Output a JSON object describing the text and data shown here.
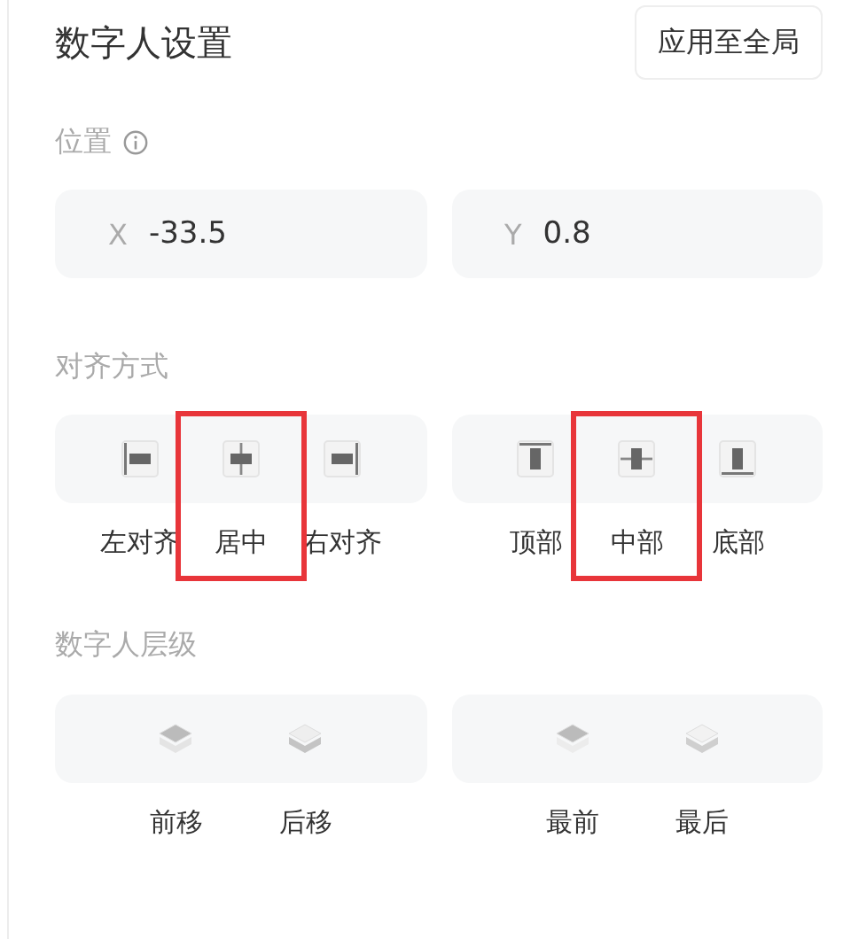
{
  "header": {
    "title": "数字人设置",
    "apply_button": "应用至全局"
  },
  "position": {
    "label": "位置",
    "fields": [
      {
        "axis": "X",
        "value": "-33.5"
      },
      {
        "axis": "Y",
        "value": "0.8"
      }
    ]
  },
  "alignment": {
    "label": "对齐方式",
    "groups": [
      {
        "items": [
          {
            "kind": "left",
            "label": "左对齐",
            "highlighted": false
          },
          {
            "kind": "hcenter",
            "label": "居中",
            "highlighted": true
          },
          {
            "kind": "right",
            "label": "右对齐",
            "highlighted": false
          }
        ]
      },
      {
        "items": [
          {
            "kind": "top",
            "label": "顶部",
            "highlighted": false
          },
          {
            "kind": "vmiddle",
            "label": "中部",
            "highlighted": true
          },
          {
            "kind": "bottom",
            "label": "底部",
            "highlighted": false
          }
        ]
      }
    ]
  },
  "layer": {
    "label": "数字人层级",
    "groups": [
      {
        "items": [
          {
            "kind": "forward",
            "label": "前移"
          },
          {
            "kind": "backward",
            "label": "后移"
          }
        ]
      },
      {
        "items": [
          {
            "kind": "front",
            "label": "最前"
          },
          {
            "kind": "back",
            "label": "最后"
          }
        ]
      }
    ]
  }
}
